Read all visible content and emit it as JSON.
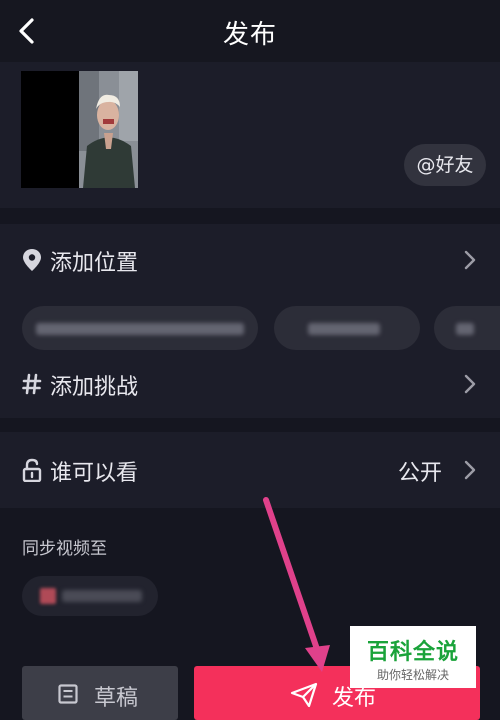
{
  "header": {
    "title": "发布"
  },
  "media": {
    "mention_label": "@好友"
  },
  "options": {
    "location_label": "添加位置",
    "challenge_label": "添加挑战"
  },
  "privacy": {
    "label": "谁可以看",
    "value": "公开"
  },
  "sync": {
    "label": "同步视频至"
  },
  "bottom": {
    "draft_label": "草稿",
    "publish_label": "发布"
  },
  "watermark": {
    "title": "百科全说",
    "subtitle": "助你轻松解决"
  },
  "colors": {
    "background": "#151620",
    "card": "#1c1d29",
    "accent": "#f4305b",
    "annotation_arrow": "#e0418b",
    "watermark_green": "#1aa33a"
  },
  "icons": [
    "back-icon",
    "location-pin-icon",
    "hashtag-icon",
    "unlock-icon",
    "chevron-right-icon",
    "draft-icon",
    "send-icon"
  ]
}
